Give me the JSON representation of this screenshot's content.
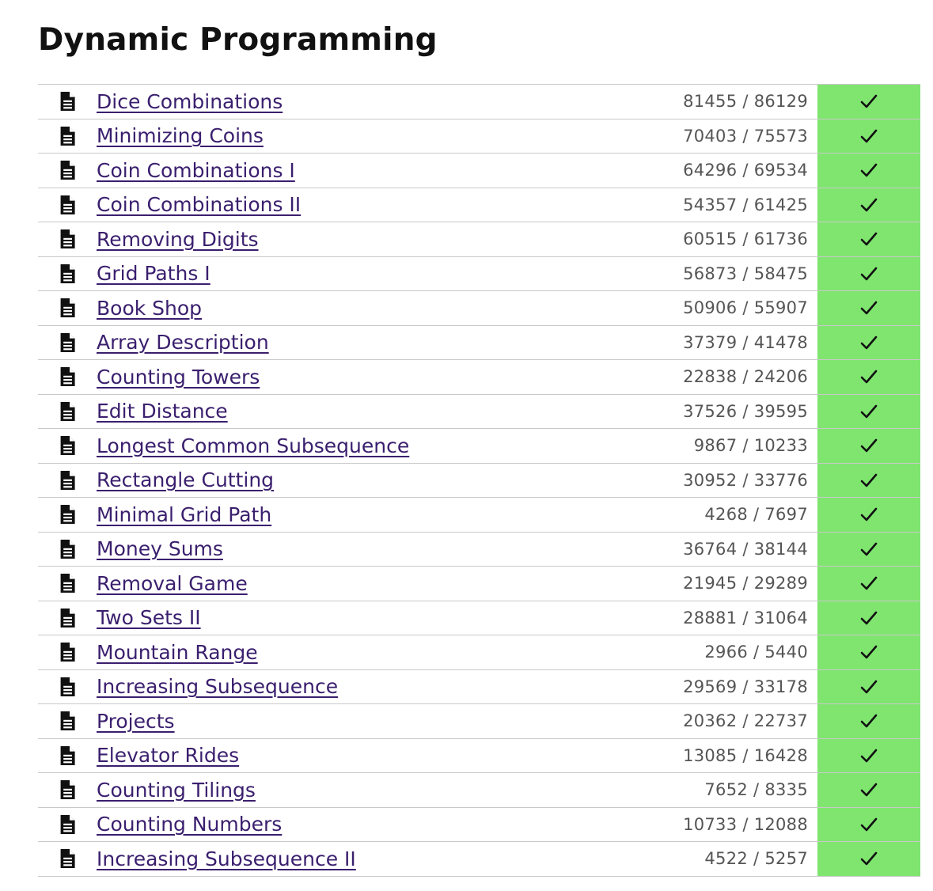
{
  "page": {
    "title": "Dynamic Programming"
  },
  "colors": {
    "link": "#3a1f6e",
    "solved_background": "#7fe56f",
    "stat_text": "#555555",
    "row_border": "#c9c9c9"
  },
  "icons": {
    "task": "document-icon",
    "solved": "check-icon"
  },
  "tasks": [
    {
      "name": "Dice Combinations",
      "stat": "81455 / 86129",
      "solved": true
    },
    {
      "name": "Minimizing Coins",
      "stat": "70403 / 75573",
      "solved": true
    },
    {
      "name": "Coin Combinations I",
      "stat": "64296 / 69534",
      "solved": true
    },
    {
      "name": "Coin Combinations II",
      "stat": "54357 / 61425",
      "solved": true
    },
    {
      "name": "Removing Digits",
      "stat": "60515 / 61736",
      "solved": true
    },
    {
      "name": "Grid Paths I",
      "stat": "56873 / 58475",
      "solved": true
    },
    {
      "name": "Book Shop",
      "stat": "50906 / 55907",
      "solved": true
    },
    {
      "name": "Array Description",
      "stat": "37379 / 41478",
      "solved": true
    },
    {
      "name": "Counting Towers",
      "stat": "22838 / 24206",
      "solved": true
    },
    {
      "name": "Edit Distance",
      "stat": "37526 / 39595",
      "solved": true
    },
    {
      "name": "Longest Common Subsequence",
      "stat": "9867 / 10233",
      "solved": true
    },
    {
      "name": "Rectangle Cutting",
      "stat": "30952 / 33776",
      "solved": true
    },
    {
      "name": "Minimal Grid Path",
      "stat": "4268 / 7697",
      "solved": true
    },
    {
      "name": "Money Sums",
      "stat": "36764 / 38144",
      "solved": true
    },
    {
      "name": "Removal Game",
      "stat": "21945 / 29289",
      "solved": true
    },
    {
      "name": "Two Sets II",
      "stat": "28881 / 31064",
      "solved": true
    },
    {
      "name": "Mountain Range",
      "stat": "2966 / 5440",
      "solved": true
    },
    {
      "name": "Increasing Subsequence",
      "stat": "29569 / 33178",
      "solved": true
    },
    {
      "name": "Projects",
      "stat": "20362 / 22737",
      "solved": true
    },
    {
      "name": "Elevator Rides",
      "stat": "13085 / 16428",
      "solved": true
    },
    {
      "name": "Counting Tilings",
      "stat": "7652 / 8335",
      "solved": true
    },
    {
      "name": "Counting Numbers",
      "stat": "10733 / 12088",
      "solved": true
    },
    {
      "name": "Increasing Subsequence II",
      "stat": "4522 / 5257",
      "solved": true
    }
  ]
}
